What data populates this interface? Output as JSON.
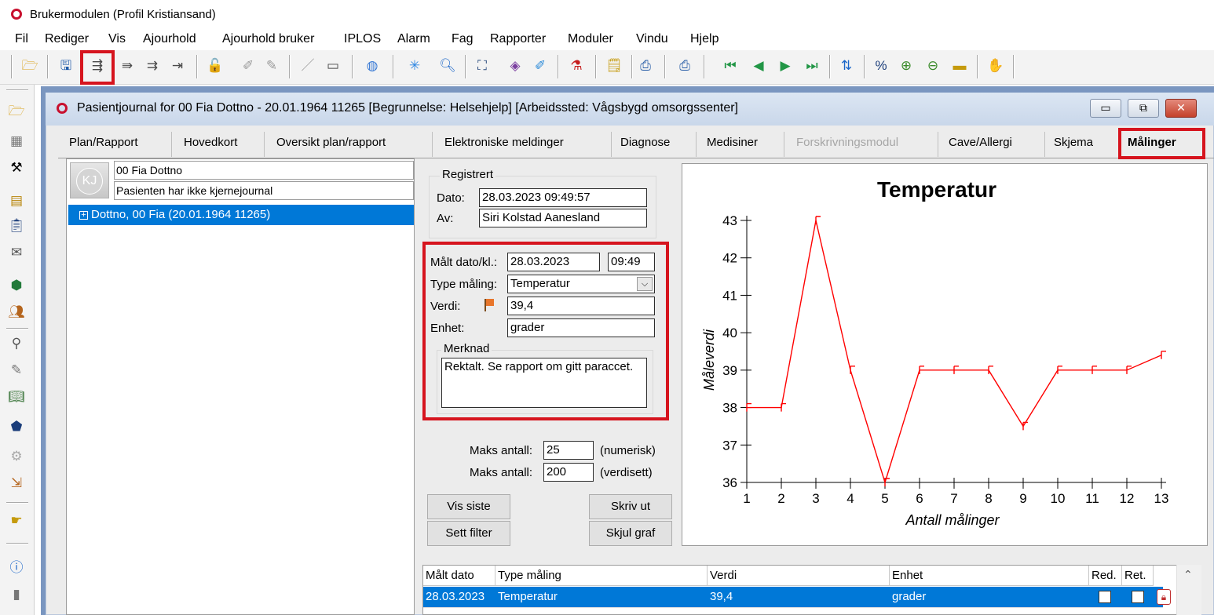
{
  "app": {
    "title": "Brukermodulen (Profil Kristiansand)"
  },
  "menu": [
    "Fil",
    "Rediger",
    "Vis",
    "Ajourhold",
    "Ajourhold bruker",
    "IPLOS",
    "Alarm",
    "Fag",
    "Rapporter",
    "Moduler",
    "Vindu",
    "Hjelp"
  ],
  "window": {
    "title": "Pasientjournal for 00 Fia Dottno - 20.01.1964 11265   [Begrunnelse: Helsehjelp] [Arbeidssted: Vågsbygd omsorgssenter]",
    "minimize": "▭",
    "restore": "⧉",
    "close": "✕"
  },
  "tabs": [
    "Plan/Rapport",
    "Hovedkort",
    "Oversikt plan/rapport",
    "Elektroniske meldinger",
    "Diagnose",
    "Medisiner",
    "Forskrivningsmodul",
    "Cave/Allergi",
    "Skjema",
    "Målinger"
  ],
  "patient": {
    "avatar": "KJ",
    "name": "00 Fia Dottno",
    "journal_status": "Pasienten har ikke kjernejournal",
    "tree_item": "Dottno, 00 Fia (20.01.1964 11265)"
  },
  "registrert": {
    "title": "Registrert",
    "dato_label": "Dato:",
    "dato": "28.03.2023 09:49:57",
    "av_label": "Av:",
    "av": "Siri Kolstad Aanesland"
  },
  "measure": {
    "dato_label": "Målt dato/kl.:",
    "dato": "28.03.2023",
    "kl": "09:49",
    "type_label": "Type måling:",
    "type": "Temperatur",
    "verdi_label": "Verdi:",
    "verdi": "39,4",
    "enhet_label": "Enhet:",
    "enhet": "grader",
    "merknad_label": "Merknad",
    "merknad": "Rektalt. Se rapport om gitt paraccet."
  },
  "maks": [
    {
      "label": "Maks antall:",
      "value": "25",
      "suffix": "(numerisk)"
    },
    {
      "label": "Maks antall:",
      "value": "200",
      "suffix": "(verdisett)"
    }
  ],
  "buttons": {
    "vis_siste": "Vis siste",
    "skriv_ut": "Skriv ut",
    "sett_filter": "Sett filter",
    "skjul_graf": "Skjul graf"
  },
  "chart_data": {
    "type": "line",
    "title": "Temperatur",
    "xlabel": "Antall målinger",
    "ylabel": "Måleverdi",
    "x": [
      1,
      2,
      3,
      4,
      5,
      6,
      7,
      8,
      9,
      10,
      11,
      12,
      13
    ],
    "series": [
      {
        "values": [
          38,
          38,
          43,
          39,
          36,
          39,
          39,
          39,
          37.5,
          39,
          39,
          39,
          39.4
        ]
      }
    ],
    "xlim": [
      1,
      13
    ],
    "ylim": [
      36,
      43
    ],
    "yticks": [
      36,
      37,
      38,
      39,
      40,
      41,
      42,
      43
    ],
    "color": "#ff0000",
    "grid": false
  },
  "table": {
    "headers": [
      "Målt dato",
      "Type måling",
      "Verdi",
      "Enhet",
      "Red.",
      "Ret."
    ],
    "rows": [
      {
        "dato": "28.03.2023",
        "type": "Temperatur",
        "verdi": "39,4",
        "enhet": "grader"
      }
    ]
  }
}
